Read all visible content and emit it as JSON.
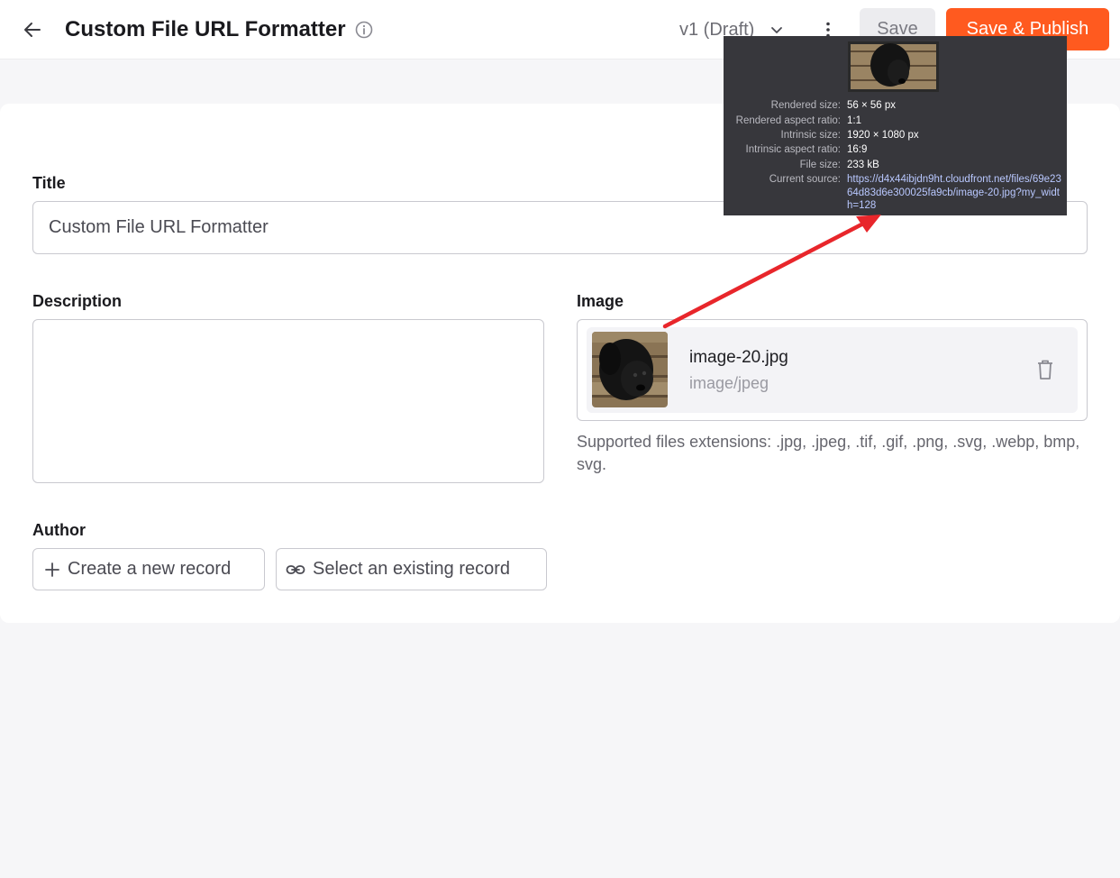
{
  "header": {
    "title": "Custom File URL Formatter",
    "version": "v1 (Draft)",
    "save_label": "Save",
    "publish_label": "Save & Publish"
  },
  "form": {
    "title_label": "Title",
    "title_value": "Custom File URL Formatter",
    "description_label": "Description",
    "description_value": "",
    "image_label": "Image",
    "file": {
      "name": "image-20.jpg",
      "type": "image/jpeg"
    },
    "help_text": "Supported files extensions: .jpg, .jpeg, .tif, .gif, .png, .svg, .webp, bmp, svg.",
    "author_label": "Author",
    "create_record_label": "Create a new record",
    "select_record_label": "Select an existing record"
  },
  "tooltip": {
    "rows": [
      {
        "key": "Rendered size:",
        "value": "56 × 56 px"
      },
      {
        "key": "Rendered aspect ratio:",
        "value": "1:1"
      },
      {
        "key": "Intrinsic size:",
        "value": "1920 × 1080 px"
      },
      {
        "key": "Intrinsic aspect ratio:",
        "value": "16:9"
      },
      {
        "key": "File size:",
        "value": "233 kB"
      },
      {
        "key": "Current source:",
        "value": "https://d4x44ibjdn9ht.cloudfront.net/files/69e2364d83d6e300025fa9cb/image-20.jpg?my_width=128"
      }
    ]
  },
  "colors": {
    "accent": "#ff5a1f",
    "annotation_arrow": "#e8262b",
    "tooltip_bg": "#37373c"
  },
  "icons": {
    "back": "arrow-left-icon",
    "info": "info-icon",
    "chevron": "chevron-down-icon",
    "more": "kebab-icon",
    "delete": "trash-icon",
    "add": "plus-icon",
    "link": "link-icon"
  }
}
